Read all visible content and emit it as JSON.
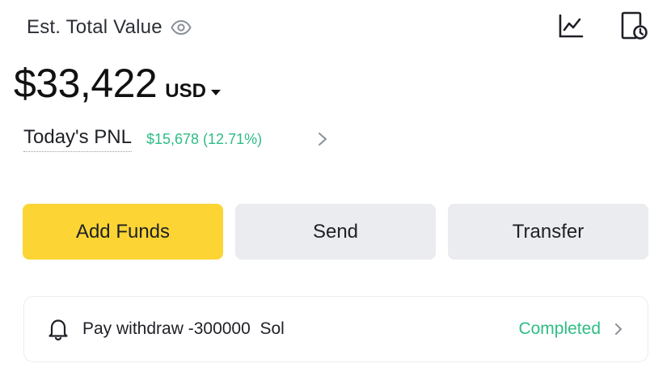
{
  "header": {
    "est_label": "Est. Total Value",
    "icons": [
      "eye-icon",
      "line-chart-icon",
      "history-icon"
    ]
  },
  "balance": {
    "amount": "$33,422",
    "currency": "USD"
  },
  "pnl": {
    "label": "Today's PNL",
    "value": "$15,678 (12.71%)",
    "color": "#2ebd85"
  },
  "actions": {
    "add_funds": "Add Funds",
    "send": "Send",
    "transfer": "Transfer",
    "primary_color": "#fcd535",
    "secondary_color": "#eaecef"
  },
  "notice": {
    "text": "Pay withdraw -300000  Sol",
    "status": "Completed",
    "status_color": "#2ebd85"
  }
}
